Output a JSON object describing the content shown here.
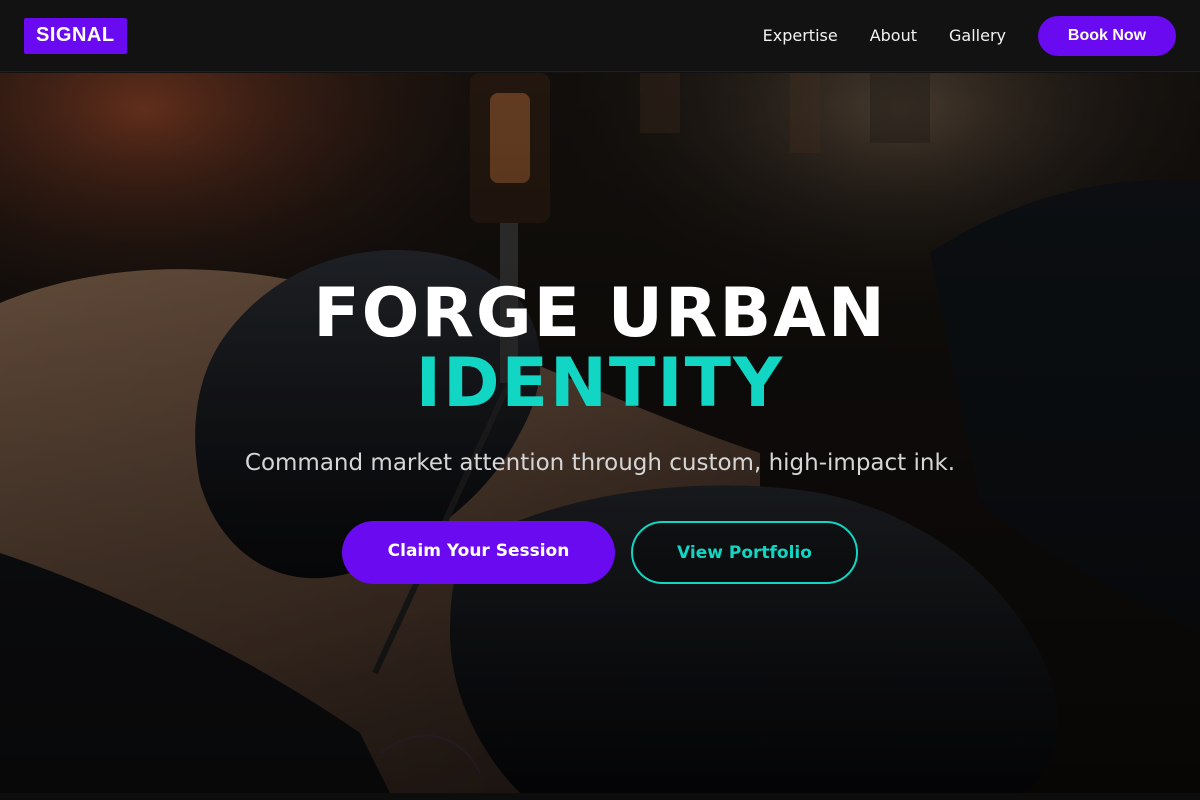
{
  "header": {
    "logo": "SIGNAL",
    "nav": [
      {
        "label": "Expertise"
      },
      {
        "label": "About"
      },
      {
        "label": "Gallery"
      }
    ],
    "cta_label": "Book Now"
  },
  "hero": {
    "headline_line1": "FORGE URBAN",
    "headline_line2": "IDENTITY",
    "subtitle": "Command market attention through custom, high-impact ink.",
    "primary_button": "Claim Your Session",
    "secondary_button": "View Portfolio",
    "background_image": "photo of gloved hands tattooing a leg with a tattoo machine"
  },
  "colors": {
    "brand_purple": "#6a0af0",
    "accent_teal": "#12d6c4",
    "header_bg": "#121212"
  }
}
